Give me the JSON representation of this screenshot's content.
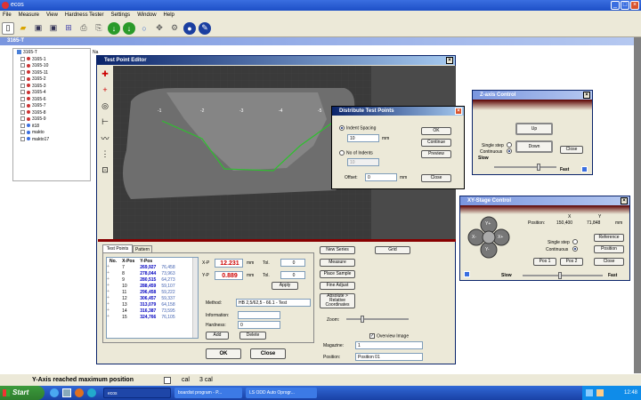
{
  "app": {
    "title": "ecos"
  },
  "menu": [
    "File",
    "Measure",
    "View",
    "Hardness Tester",
    "Settings",
    "Window",
    "Help"
  ],
  "tree": {
    "root": "3165-T",
    "items": [
      "3165-T",
      "3165-1",
      "3165-10",
      "3165-11",
      "3165-2",
      "3165-3",
      "3165-4",
      "3165-6",
      "3165-7",
      "3165-8",
      "3165-9",
      "it18",
      "makto",
      "makto17"
    ],
    "header": "Na"
  },
  "test_point_editor": {
    "title": "Test Point Editor",
    "point_labels": [
      "-1",
      "-2",
      "-3",
      "-4",
      "-5"
    ],
    "tabs": [
      "Test Points",
      "Pattern"
    ],
    "columns": [
      "No.",
      "X-Pos",
      "Y-Pos"
    ],
    "rows": [
      [
        "7",
        "269,927",
        "76,458"
      ],
      [
        "8",
        "278,044",
        "73,963"
      ],
      [
        "9",
        "280,515",
        "64,273"
      ],
      [
        "10",
        "288,459",
        "59,107"
      ],
      [
        "11",
        "296,458",
        "59,222"
      ],
      [
        "12",
        "306,457",
        "59,337"
      ],
      [
        "13",
        "313,079",
        "64,158"
      ],
      [
        "14",
        "316,387",
        "73,595"
      ],
      [
        "15",
        "324,766",
        "76,105"
      ]
    ],
    "xp_label": "X-P",
    "xp_value": "12.231",
    "yp_label": "Y-P",
    "yp_value": "0.889",
    "unit": "mm",
    "tol_label": "Tol.",
    "tol_x": "0",
    "tol_y": "0",
    "apply_label": "Apply",
    "method_label": "Method:",
    "method_value": "HB 2,5/62,5 - 66.1 - Test",
    "information_label": "Information:",
    "hardness_label": "Hardness:",
    "hardness_value": "0",
    "add_label": "Add",
    "delete_label": "Delete",
    "new_series": "New Series",
    "grid": "Grid",
    "measure": "Measure",
    "place_sample": "Place Sample",
    "fine_adjust": "Fine Adjust",
    "abs_rel": "Absolute > Relative Coordinates",
    "zoom_label": "Zoom:",
    "overview_label": "Overview Image",
    "magazine_label": "Magazine:",
    "magazine_value": "1",
    "position_label": "Position:",
    "position_value": "Position 01",
    "ok_label": "OK",
    "close_label": "Close"
  },
  "distribute": {
    "title": "Distribute Test Points",
    "indent_spacing": "Indent Spacing",
    "spacing_value": "10",
    "unit": "mm",
    "no_of_indents": "No of Indents",
    "indents_value": "10",
    "offset_label": "Offset:",
    "offset_value": "0",
    "ok": "OK",
    "continue": "Continue",
    "preview": "Preview",
    "close": "Close"
  },
  "z_axis": {
    "title": "Z-axis Control",
    "up": "Up",
    "down": "Down",
    "single_step": "Single step",
    "continuous": "Continuous",
    "slow": "Slow",
    "fast": "Fast",
    "close": "Close"
  },
  "xy_stage": {
    "title": "XY-Stage Control",
    "x_label": "X",
    "y_label": "Y",
    "position_label": "Position:",
    "x_value": "150,400",
    "y_value": "71,848",
    "unit": "mm",
    "single_step": "Single step",
    "continuous": "Continuous",
    "reference": "Reference",
    "position_btn": "Position",
    "pos1": "Pos 1",
    "pos2": "Pos 2",
    "close": "Close",
    "slow": "Slow",
    "fast": "Fast",
    "joystick": [
      "Y+",
      "Y-",
      "X-",
      "X+"
    ]
  },
  "status": {
    "message": "Y-Axis reached maximum position",
    "field1": "cal",
    "field2": "3 cal"
  },
  "taskbar": {
    "start": "Start",
    "tasks": [
      "ecos",
      "boardist program - P...",
      "LS ODD Auto Oprogr..."
    ],
    "clock": "12:48"
  },
  "colors": {
    "title_blue": "#0a246a",
    "value_red": "#c00000",
    "taskbar": "#245edb"
  }
}
